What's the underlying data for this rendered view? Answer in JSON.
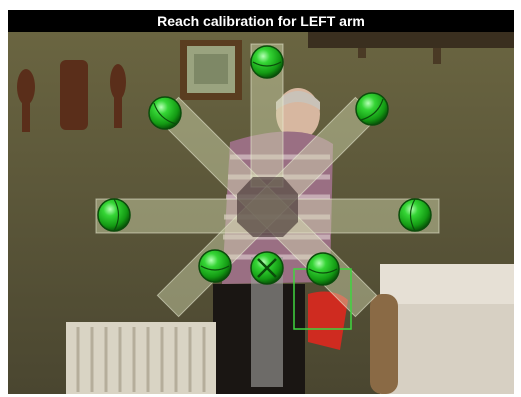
{
  "window": {
    "title": "Reach calibration for LEFT arm"
  },
  "calibration": {
    "arm": "LEFT",
    "targets": [
      {
        "name": "top",
        "state": "pending"
      },
      {
        "name": "upper-left",
        "state": "pending"
      },
      {
        "name": "upper-right",
        "state": "pending"
      },
      {
        "name": "left",
        "state": "pending"
      },
      {
        "name": "right",
        "state": "pending"
      },
      {
        "name": "lower-left",
        "state": "pending"
      },
      {
        "name": "center",
        "state": "selected"
      },
      {
        "name": "lower-right",
        "state": "pending"
      }
    ],
    "colors": {
      "target_fill": "#2fc92f",
      "target_dark": "#0b4d0b",
      "arm_band": "#d4dcb2",
      "tracking_box": "#3fd63f",
      "title_bg": "#000000",
      "title_text": "#ffffff"
    }
  }
}
